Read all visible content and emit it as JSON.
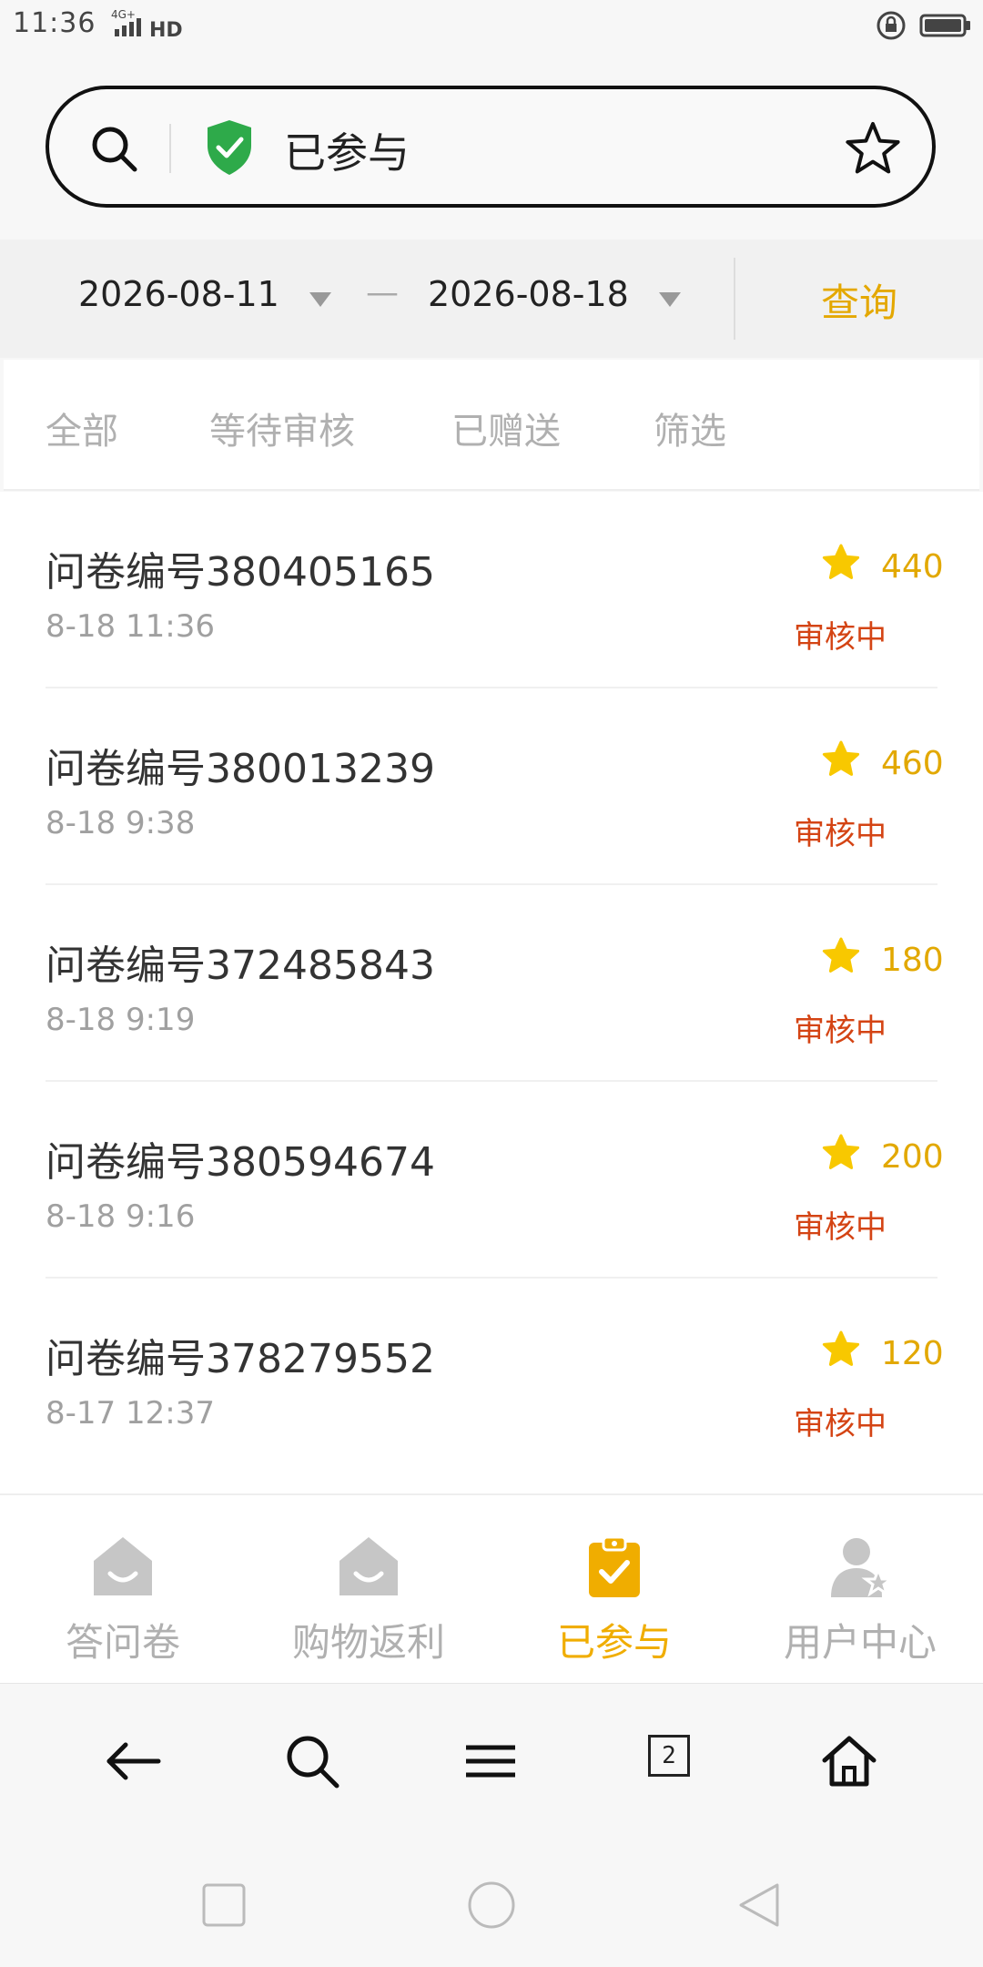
{
  "status_bar": {
    "time": "11:36",
    "network": "4G+",
    "hd": "HD"
  },
  "search": {
    "text": "已参与"
  },
  "date_filter": {
    "start": "2026-08-11",
    "dash": "—",
    "end": "2026-08-18",
    "query_label": "查询"
  },
  "tabs": [
    {
      "label": "全部"
    },
    {
      "label": "等待审核"
    },
    {
      "label": "已赠送"
    },
    {
      "label": "筛选"
    }
  ],
  "surveys": [
    {
      "title": "问卷编号380405165",
      "time": "8-18 11:36",
      "points": "440",
      "status": "审核中"
    },
    {
      "title": "问卷编号380013239",
      "time": "8-18 9:38",
      "points": "460",
      "status": "审核中"
    },
    {
      "title": "问卷编号372485843",
      "time": "8-18 9:19",
      "points": "180",
      "status": "审核中"
    },
    {
      "title": "问卷编号380594674",
      "time": "8-18 9:16",
      "points": "200",
      "status": "审核中"
    },
    {
      "title": "问卷编号378279552",
      "time": "8-17 12:37",
      "points": "120",
      "status": "审核中"
    }
  ],
  "bottom_nav": [
    {
      "label": "答问卷",
      "icon": "house-icon"
    },
    {
      "label": "购物返利",
      "icon": "house-icon"
    },
    {
      "label": "已参与",
      "icon": "clipboard-check-icon",
      "active": true
    },
    {
      "label": "用户中心",
      "icon": "user-star-icon"
    }
  ],
  "browser_toolbar": {
    "tab_count": "2"
  },
  "colors": {
    "accent": "#f0ad00",
    "status": "#d44414",
    "shield": "#2eaa4a"
  }
}
